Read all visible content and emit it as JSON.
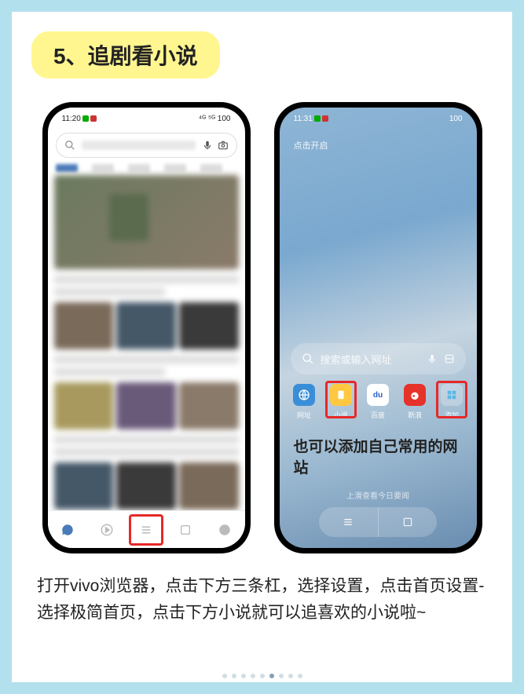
{
  "title": "5、追剧看小说",
  "phone1": {
    "status_time": "11:20",
    "status_right": "⁴ᴳ ⁵ᴳ 100",
    "search_placeholder": ""
  },
  "phone2": {
    "status_time": "11:31",
    "status_right": "100",
    "hint": "点击开启",
    "search_placeholder": "搜索或输入网址",
    "icons": [
      {
        "label": "网址",
        "key": "url"
      },
      {
        "label": "小说",
        "key": "novel"
      },
      {
        "label": "百度",
        "key": "baidu"
      },
      {
        "label": "新浪",
        "key": "sina"
      },
      {
        "label": "添加",
        "key": "add"
      }
    ],
    "annotation": "也可以添加自己常用的网站",
    "swipe_hint": "上滑查看今日要闻"
  },
  "instruction": "打开vivo浏览器，点击下方三条杠，选择设置，点击首页设置-选择极简首页，点击下方小说就可以追喜欢的小说啦~"
}
